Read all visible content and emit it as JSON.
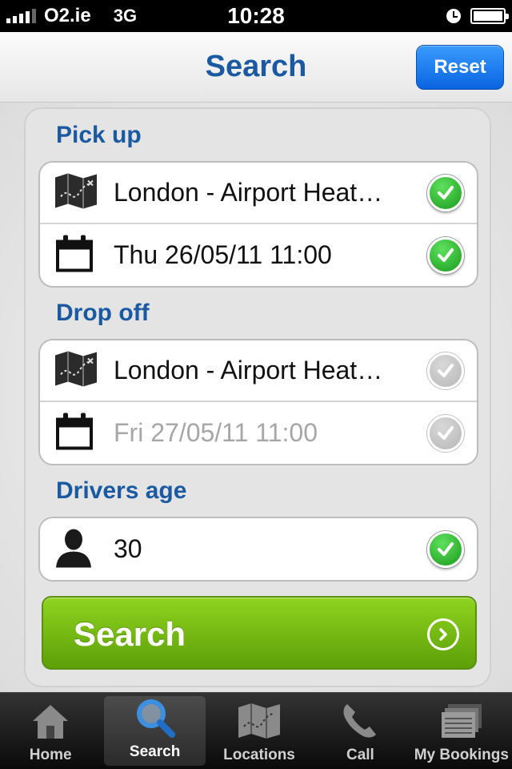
{
  "status_bar": {
    "carrier": "O2.ie",
    "network": "3G",
    "time": "10:28",
    "battery_level": 1.0
  },
  "nav": {
    "title": "Search",
    "reset_label": "Reset"
  },
  "pickup": {
    "section_label": "Pick up",
    "location": "London - Airport Heat…",
    "datetime": "Thu 26/05/11 11:00",
    "location_checked": true,
    "datetime_checked": true
  },
  "dropoff": {
    "section_label": "Drop off",
    "location": "London - Airport Heat…",
    "datetime": "Fri 27/05/11 11:00",
    "location_checked": false,
    "datetime_checked": false
  },
  "drivers_age": {
    "section_label": "Drivers age",
    "value": "30",
    "checked": true
  },
  "search_button_label": "Search",
  "tabs": [
    {
      "label": "Home",
      "icon": "home-icon",
      "selected": false
    },
    {
      "label": "Search",
      "icon": "magnifier-icon",
      "selected": true
    },
    {
      "label": "Locations",
      "icon": "map-icon",
      "selected": false
    },
    {
      "label": "Call",
      "icon": "phone-icon",
      "selected": false
    },
    {
      "label": "My Bookings",
      "icon": "bookings-icon",
      "selected": false
    }
  ],
  "colors": {
    "accent_blue": "#1b5aa0",
    "reset_blue": "#0a64e0",
    "search_green": "#6fb80f",
    "check_green": "#1a9a1a"
  }
}
